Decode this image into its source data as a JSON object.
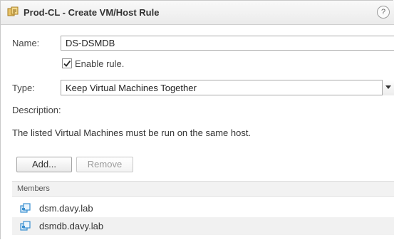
{
  "dialog": {
    "title": "Prod-CL - Create VM/Host Rule",
    "help_label": "?"
  },
  "form": {
    "name_label": "Name:",
    "name_value": "DS-DSMDB",
    "enable_rule_label": "Enable rule.",
    "enable_rule_checked": true,
    "type_label": "Type:",
    "type_value": "Keep Virtual Machines Together",
    "description_label": "Description:",
    "description_text": "The listed Virtual Machines must be run on the same host."
  },
  "members": {
    "add_label": "Add...",
    "remove_label": "Remove",
    "header": "Members",
    "items": [
      {
        "name": "dsm.davy.lab",
        "icon": "vm-icon"
      },
      {
        "name": "dsmdb.davy.lab",
        "icon": "vm-icon"
      }
    ]
  },
  "colors": {
    "vm_icon": "#3a8fd0",
    "title_icon": "#d9a63a"
  }
}
